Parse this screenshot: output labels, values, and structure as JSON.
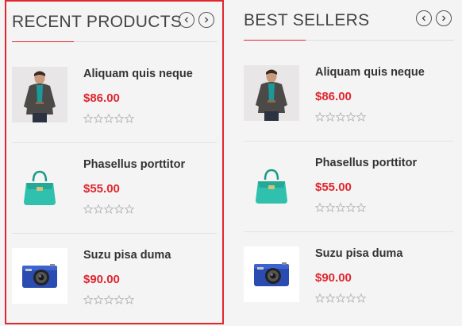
{
  "widgets": [
    {
      "title": "RECENT PRODUCTS",
      "items": [
        {
          "name": "Aliquam quis neque",
          "price": "$86.00",
          "image": "man-jacket-photo",
          "rating": 0
        },
        {
          "name": "Phasellus porttitor",
          "price": "$55.00",
          "image": "teal-handbag-photo",
          "rating": 0
        },
        {
          "name": "Suzu pisa duma",
          "price": "$90.00",
          "image": "blue-camera-photo",
          "rating": 0
        }
      ]
    },
    {
      "title": "BEST SELLERS",
      "items": [
        {
          "name": "Aliquam quis neque",
          "price": "$86.00",
          "image": "man-jacket-photo",
          "rating": 0
        },
        {
          "name": "Phasellus porttitor",
          "price": "$55.00",
          "image": "teal-handbag-photo",
          "rating": 0
        },
        {
          "name": "Suzu pisa duma",
          "price": "$90.00",
          "image": "blue-camera-photo",
          "rating": 0
        }
      ]
    }
  ],
  "colors": {
    "accent": "#e0272f",
    "price": "#e0272f",
    "background": "#f4f4f4",
    "title": "#444444"
  }
}
